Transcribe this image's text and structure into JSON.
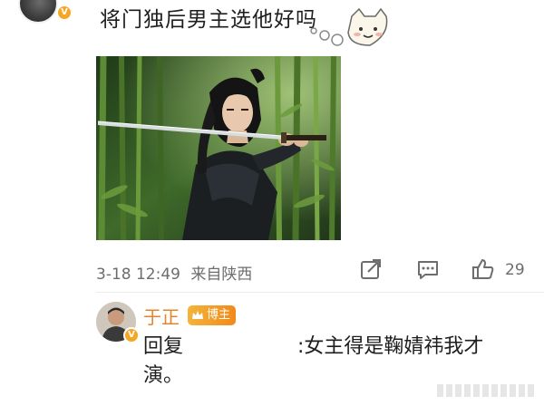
{
  "post": {
    "text": "将门独后男主选他好吗",
    "time": "3-18 12:49",
    "source": "来自陕西",
    "likes": "29"
  },
  "icons": {
    "share": "share-icon",
    "comment": "comment-icon",
    "like": "thumbs-up-icon",
    "verified": "verified-badge-icon",
    "crown": "crown-icon"
  },
  "reply": {
    "author": "于正",
    "badge": "博主",
    "prefix": "回复",
    "text_line1": ":女主得是鞠婧祎我才",
    "text_line2": "演。"
  },
  "colors": {
    "name_orange": "#e5832a",
    "badge_orange": "#f08a1c",
    "verified_gold": "#f5a623",
    "meta_gray": "#6d6d6d"
  }
}
